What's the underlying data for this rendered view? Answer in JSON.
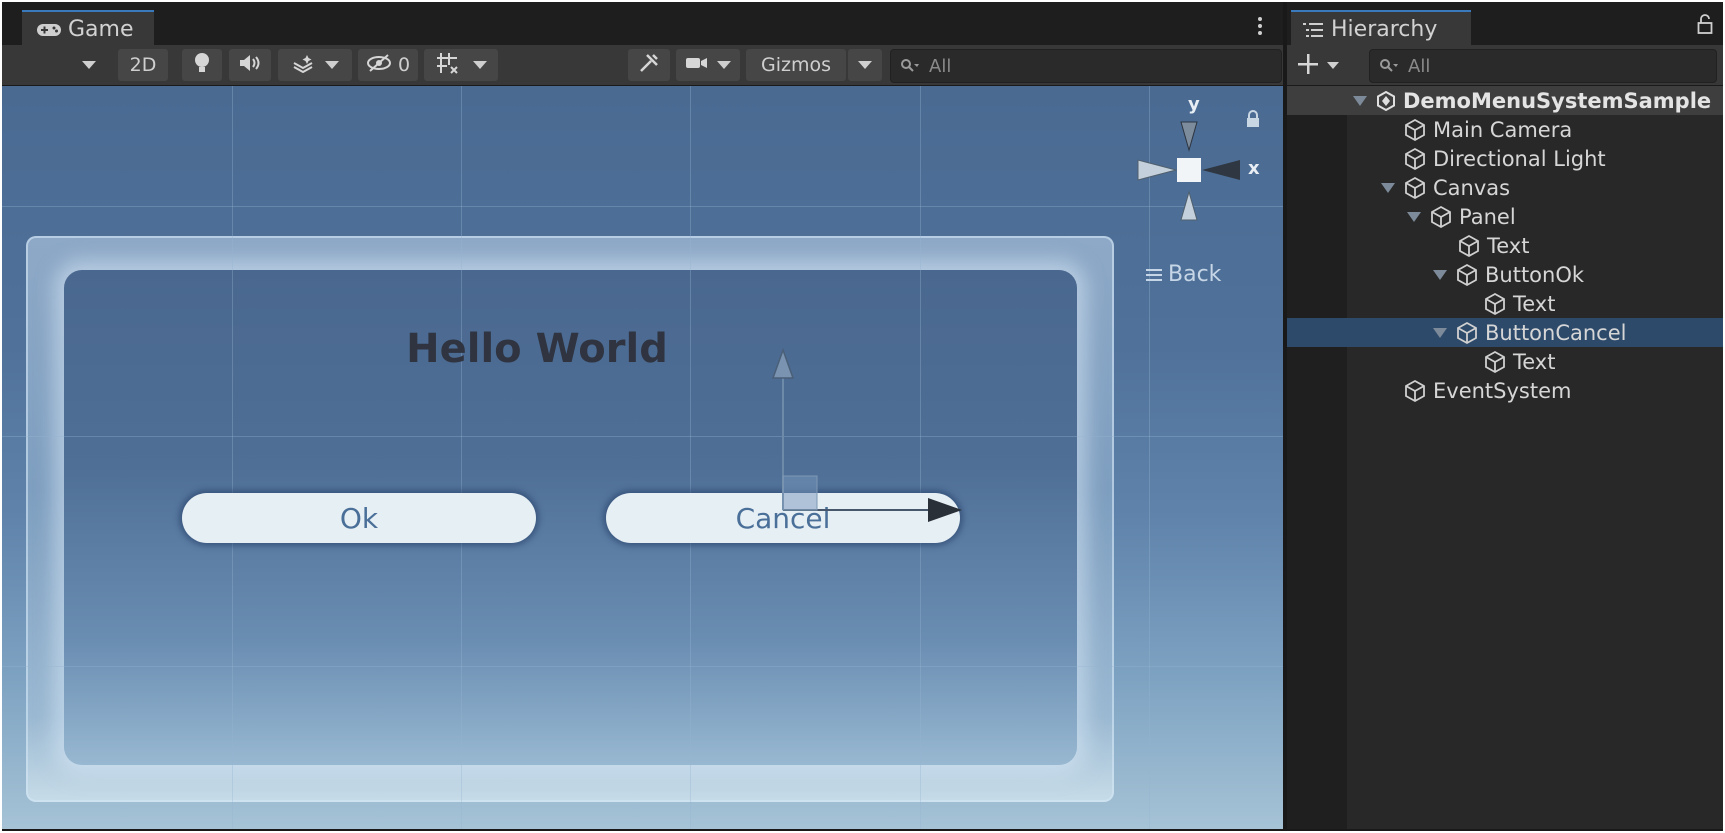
{
  "game": {
    "tab_label": "Game",
    "tab_icon": "gamepad-icon",
    "toolbar": {
      "mode_2d": "2D",
      "hidden_count": "0",
      "gizmos_label": "Gizmos",
      "search_placeholder": "All"
    },
    "scene": {
      "title": "Hello World",
      "ok_label": "Ok",
      "cancel_label": "Cancel",
      "gizmo_y": "y",
      "gizmo_x": "x",
      "view_label": "Back"
    }
  },
  "hierarchy": {
    "tab_label": "Hierarchy",
    "search_placeholder": "All",
    "items": [
      {
        "name": "DemoMenuSystemSample",
        "expanded": true,
        "type": "scene"
      },
      {
        "name": "Main Camera",
        "type": "gameobject"
      },
      {
        "name": "Directional Light",
        "type": "gameobject"
      },
      {
        "name": "Canvas",
        "expanded": true,
        "type": "gameobject"
      },
      {
        "name": "Panel",
        "expanded": true,
        "type": "gameobject"
      },
      {
        "name": "Text",
        "type": "gameobject"
      },
      {
        "name": "ButtonOk",
        "expanded": true,
        "type": "gameobject"
      },
      {
        "name": "Text",
        "type": "gameobject"
      },
      {
        "name": "ButtonCancel",
        "expanded": true,
        "selected": true,
        "type": "gameobject"
      },
      {
        "name": "Text",
        "type": "gameobject"
      },
      {
        "name": "EventSystem",
        "type": "gameobject"
      }
    ]
  },
  "colors": {
    "selection": "#2d4a6b",
    "tab_accent": "#3a79bb",
    "panel_bg": "#282828"
  }
}
